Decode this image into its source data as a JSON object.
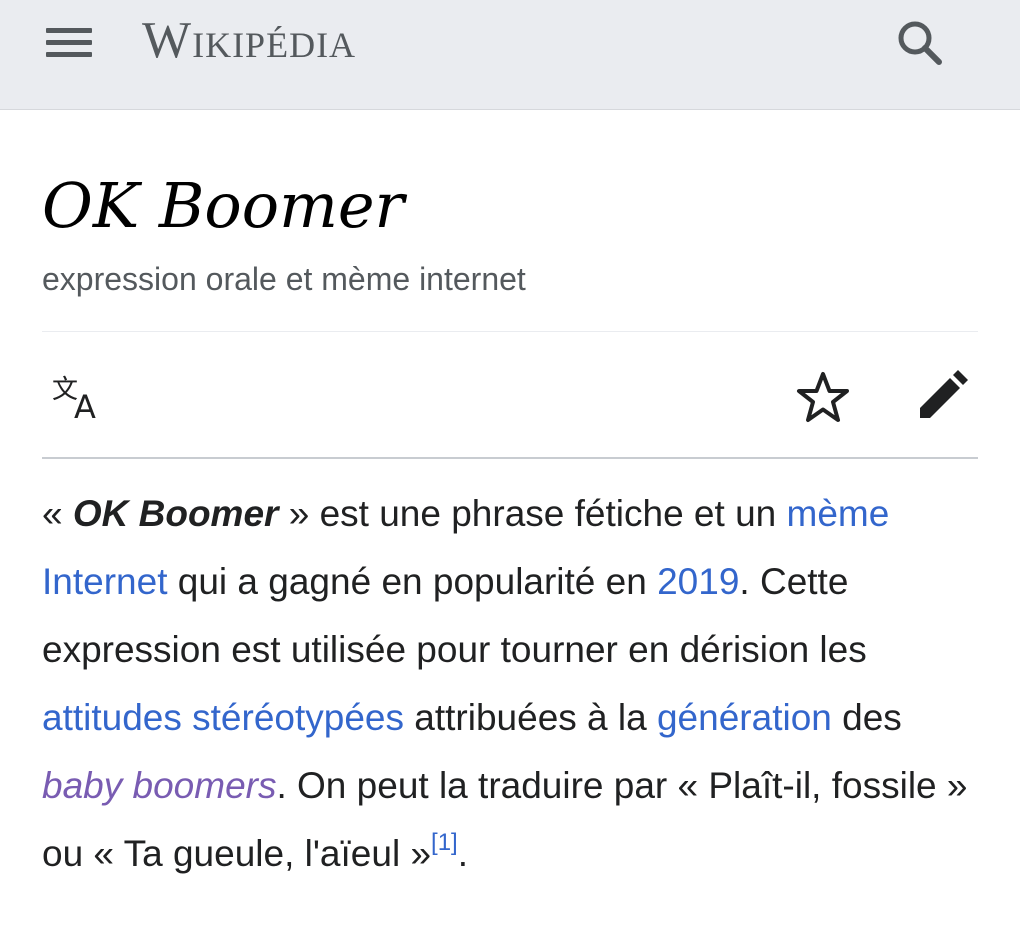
{
  "header": {
    "wordmark": "Wikipédia",
    "menu_icon": "hamburger-menu-icon",
    "search_icon": "search-icon",
    "background": "#eaecf0"
  },
  "article": {
    "title": "OK Boomer",
    "description": "expression orale et mème internet",
    "actions": {
      "language_icon": "translate-icon",
      "watch_icon": "star-icon",
      "edit_icon": "pencil-icon"
    },
    "paragraph": {
      "open_quote": "« ",
      "bold_term": "OK Boomer",
      "t1": " » est une phrase fétiche et un ",
      "link_meme": "mème Internet",
      "t2": " qui a gagné en popularité en ",
      "link_2019": "2019",
      "t3": ". Cette expression est utilisée pour tourner en dérision les ",
      "link_attitudes": "attitudes stéréotypées",
      "t4": " attribuées à la ",
      "link_generation": "génération",
      "t5": " des ",
      "link_baby_boomers": "baby boomers",
      "t6": ". On peut la traduire par « Plaît-il, fossile » ou « Ta gueule, l'aïeul »",
      "ref": "[1]",
      "t7": "."
    }
  },
  "colors": {
    "link": "#3366cc",
    "visited_link": "#795cb2",
    "text": "#202122",
    "muted": "#54595d"
  }
}
